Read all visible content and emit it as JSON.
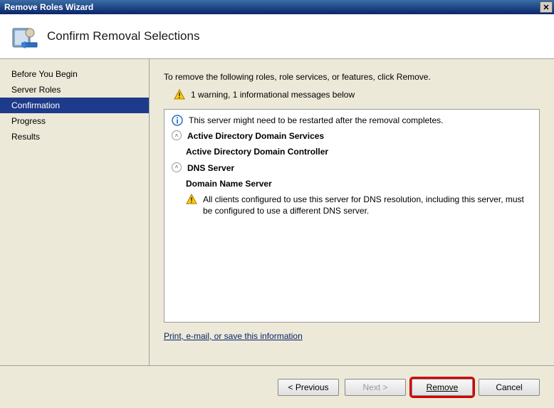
{
  "window": {
    "title": "Remove Roles Wizard"
  },
  "header": {
    "title": "Confirm Removal Selections"
  },
  "sidebar": {
    "items": [
      {
        "label": "Before You Begin"
      },
      {
        "label": "Server Roles"
      },
      {
        "label": "Confirmation"
      },
      {
        "label": "Progress"
      },
      {
        "label": "Results"
      }
    ],
    "selected_index": 2
  },
  "main": {
    "intro": "To remove the following roles, role services, or features, click Remove.",
    "warn_summary": "1 warning, 1 informational messages below",
    "rows": [
      {
        "icon": "info-icon",
        "bold": false,
        "indent": 0,
        "text": "This server might need to be restarted after the removal completes."
      },
      {
        "icon": "chevron-up-icon",
        "bold": true,
        "indent": 0,
        "text": "Active Directory Domain Services"
      },
      {
        "icon": null,
        "bold": true,
        "indent": 1,
        "text": "Active Directory Domain Controller"
      },
      {
        "icon": "chevron-up-icon",
        "bold": true,
        "indent": 0,
        "text": "DNS Server"
      },
      {
        "icon": null,
        "bold": true,
        "indent": 1,
        "text": "Domain Name Server"
      },
      {
        "icon": "warning-icon",
        "bold": false,
        "indent": 2,
        "text": "All clients configured to use this server for DNS resolution, including this server, must be configured to use a different DNS server."
      }
    ],
    "link": "Print, e-mail, or save this information"
  },
  "footer": {
    "previous": "< Previous",
    "next": "Next >",
    "remove": "Remove",
    "cancel": "Cancel"
  }
}
